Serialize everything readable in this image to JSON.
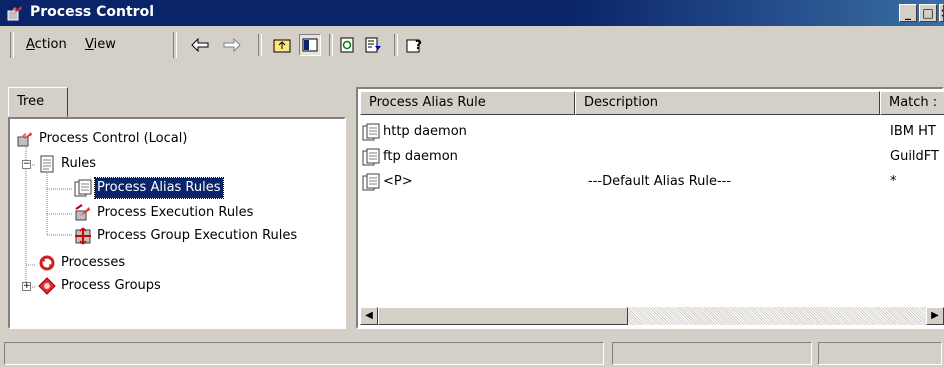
{
  "window": {
    "title": "Process Control"
  },
  "menu": {
    "action": "Action",
    "action_key": "A",
    "action_rest": "ction",
    "view": "View",
    "view_key": "V",
    "view_rest": "iew"
  },
  "toolbar_icons": [
    "back-arrow-icon",
    "forward-arrow-icon",
    "up-folder-icon",
    "show-hide-tree-icon",
    "refresh-icon",
    "export-list-icon",
    "help-icon"
  ],
  "tree": {
    "tab": "Tree",
    "items": [
      {
        "label": "Process Control (Local)",
        "icon": "process-control-icon"
      },
      {
        "label": "Rules",
        "icon": "rules-folder-icon"
      },
      {
        "label": "Process Alias Rules",
        "icon": "alias-rules-icon",
        "selected": true
      },
      {
        "label": "Process Execution Rules",
        "icon": "execution-rules-icon"
      },
      {
        "label": "Process Group Execution Rules",
        "icon": "group-execution-rules-icon"
      },
      {
        "label": "Processes",
        "icon": "processes-icon"
      },
      {
        "label": "Process Groups",
        "icon": "process-groups-icon"
      }
    ]
  },
  "list": {
    "columns": [
      "Process Alias Rule",
      "Description",
      "Match :"
    ],
    "rows": [
      {
        "name": "http daemon",
        "description": "",
        "match": "IBM HT"
      },
      {
        "name": "ftp daemon",
        "description": "",
        "match": "GuildFT"
      },
      {
        "name": "<P>",
        "description": "---Default Alias Rule---",
        "match": "*"
      }
    ]
  },
  "colors": {
    "titlebar": "#0a246a",
    "face": "#d4d0c8",
    "selection": "#0a246a"
  }
}
